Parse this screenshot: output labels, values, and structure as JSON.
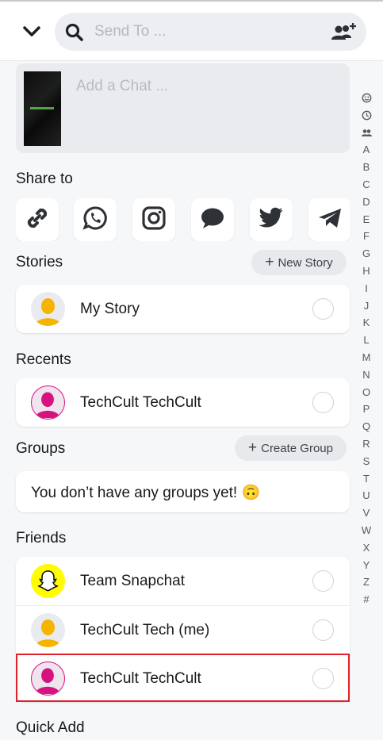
{
  "header": {
    "search_placeholder": "Send To ...",
    "icons": [
      "chevron-down-icon",
      "search-icon",
      "add-friend-icon"
    ]
  },
  "chat": {
    "placeholder": "Add a Chat ..."
  },
  "share": {
    "title": "Share to",
    "apps": [
      "link",
      "whatsapp",
      "instagram",
      "messages",
      "twitter",
      "telegram"
    ]
  },
  "stories": {
    "title": "Stories",
    "new_label": "New Story",
    "items": [
      {
        "name": "My Story",
        "avatar": "yellow"
      }
    ]
  },
  "recents": {
    "title": "Recents",
    "items": [
      {
        "name": "TechCult TechCult",
        "avatar": "pink"
      }
    ]
  },
  "groups": {
    "title": "Groups",
    "create_label": "Create Group",
    "empty_text": "You don’t have any groups yet! 🙃"
  },
  "friends": {
    "title": "Friends",
    "items": [
      {
        "name": "Team Snapchat",
        "avatar": "snapchat"
      },
      {
        "name": "TechCult Tech (me)",
        "avatar": "yellow"
      },
      {
        "name": "TechCult TechCult",
        "avatar": "pink",
        "highlighted": true
      }
    ]
  },
  "quick_add": {
    "title": "Quick Add"
  },
  "index_letters": [
    "A",
    "B",
    "C",
    "D",
    "E",
    "F",
    "G",
    "H",
    "I",
    "J",
    "K",
    "L",
    "M",
    "N",
    "O",
    "P",
    "Q",
    "R",
    "S",
    "T",
    "U",
    "V",
    "W",
    "X",
    "Y",
    "Z",
    "#"
  ],
  "colors": {
    "accent_highlight": "#e3202a",
    "avatar_yellow": "#f5b400",
    "avatar_pink": "#d6127f",
    "snapchat_yellow": "#fffc00"
  }
}
